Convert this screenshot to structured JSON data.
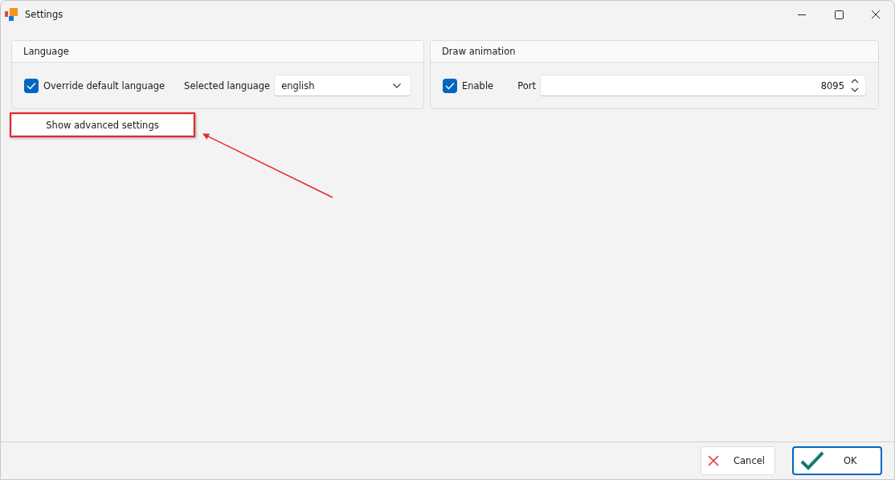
{
  "window": {
    "title": "Settings"
  },
  "panels": [
    {
      "title": "Language",
      "kind": "language",
      "checkbox": {
        "label": "Override default language",
        "checked": true
      },
      "field_label": "Selected language",
      "dropdown": {
        "value": "english"
      }
    },
    {
      "title": "Draw animation",
      "kind": "port",
      "checkbox": {
        "label": "Enable",
        "checked": true
      },
      "field_label": "Port",
      "spinner": {
        "value": "8095"
      }
    }
  ],
  "advanced_button": {
    "label": "Show advanced settings"
  },
  "buttons": [
    {
      "label": "Cancel",
      "kind": "cancel"
    },
    {
      "label": "OK",
      "kind": "ok"
    }
  ]
}
